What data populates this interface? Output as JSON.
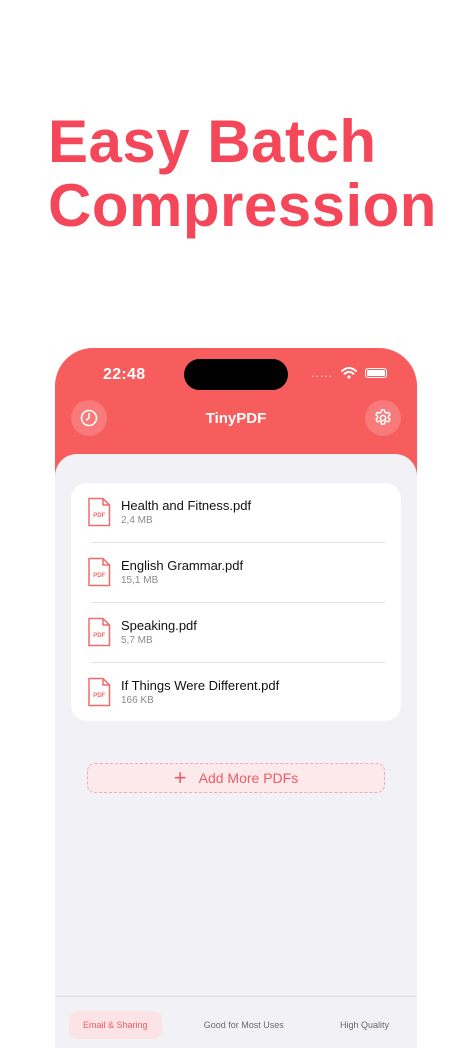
{
  "headline": {
    "line1": "Easy Batch",
    "line2": "Compression"
  },
  "status_bar": {
    "time": "22:48",
    "signal": "....."
  },
  "nav": {
    "title": "TinyPDF"
  },
  "files": [
    {
      "name": "Health and Fitness.pdf",
      "size": "2,4 MB",
      "icon_label": "PDF"
    },
    {
      "name": "English Grammar.pdf",
      "size": "15,1 MB",
      "icon_label": "PDF"
    },
    {
      "name": "Speaking.pdf",
      "size": "5,7 MB",
      "icon_label": "PDF"
    },
    {
      "name": "If Things Were Different.pdf",
      "size": "166 KB",
      "icon_label": "PDF"
    }
  ],
  "add_button": {
    "label": "Add More PDFs"
  },
  "quality_tabs": [
    {
      "label": "Email & Sharing",
      "active": true
    },
    {
      "label": "Good for Most Uses",
      "active": false
    },
    {
      "label": "High Quality",
      "active": false
    }
  ],
  "colors": {
    "brand": "#f75d5d",
    "headline": "#f4485a",
    "background": "#f2f1f5"
  }
}
